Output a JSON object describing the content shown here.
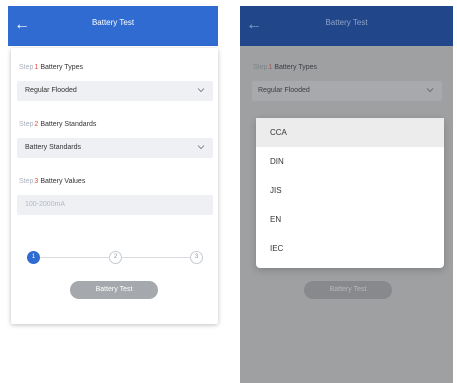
{
  "left_screen": {
    "appbar": {
      "back_icon": "arrow-left-icon",
      "title": "Battery Test"
    },
    "steps": [
      {
        "step_word": "Step",
        "number": "1",
        "label": "Battery Types",
        "value": "Regular Flooded"
      },
      {
        "step_word": "Step",
        "number": "2",
        "label": "Battery Standards",
        "value": "Battery Standards"
      },
      {
        "step_word": "Step",
        "number": "3",
        "label": "Battery Values",
        "placeholder": "100-2000mA"
      }
    ],
    "stepper": [
      "1",
      "2",
      "3"
    ],
    "button_label": "Battery Test"
  },
  "right_screen": {
    "appbar": {
      "back_icon": "arrow-left-icon",
      "title": "Battery Test"
    },
    "steps": [
      {
        "step_word": "Step",
        "number": "1",
        "label": "Battery Types",
        "value": "Regular Flooded"
      }
    ],
    "dropdown": {
      "options": [
        "CCA",
        "DIN",
        "JIS",
        "EN",
        "IEC"
      ],
      "selected": "CCA"
    },
    "button_label": "Battery Test"
  },
  "colors": {
    "primary": "#2f6bd1",
    "step_number": "#e34b3e",
    "overlay": "#9ea0a2"
  }
}
